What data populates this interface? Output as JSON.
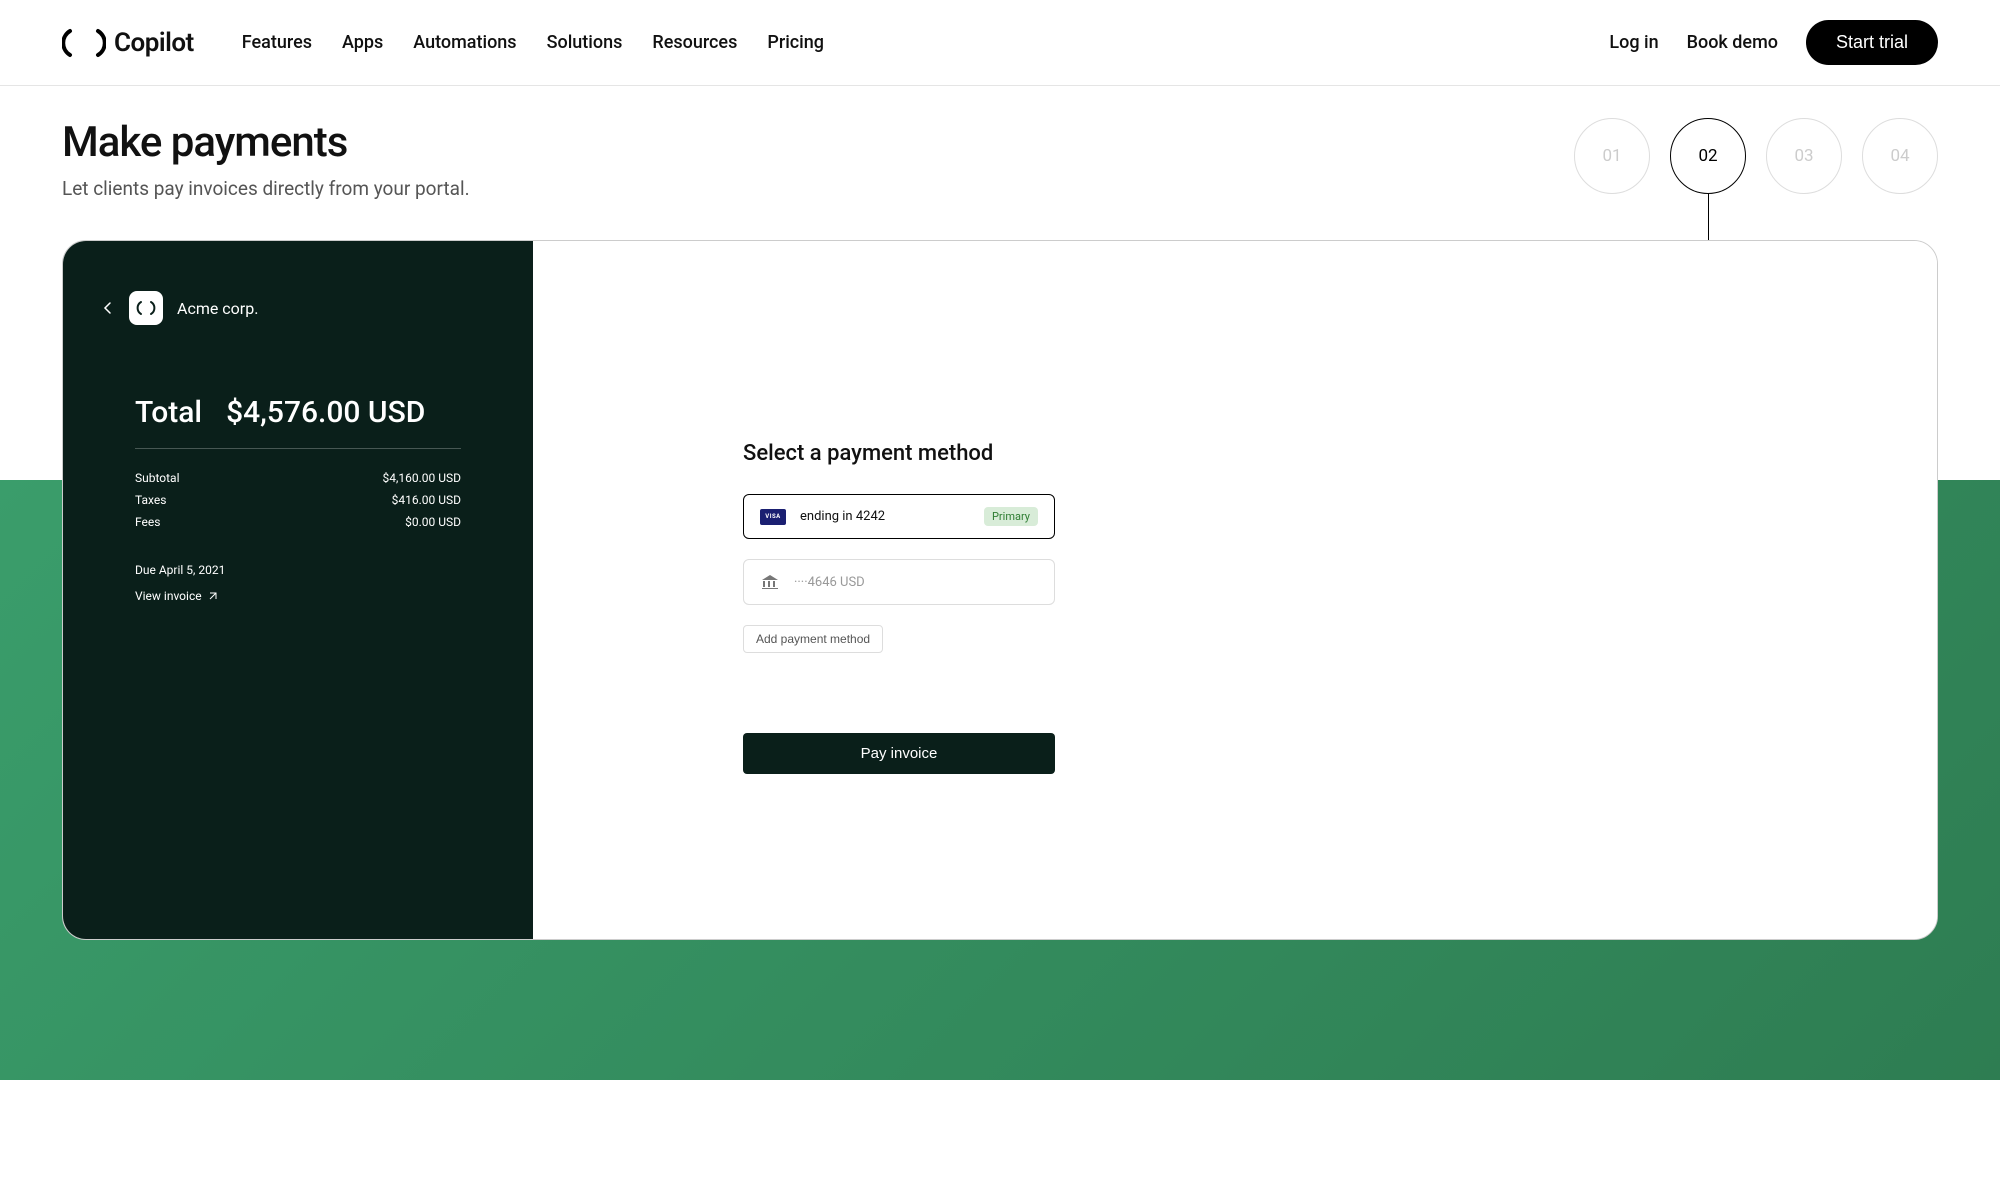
{
  "header": {
    "brand": "Copilot",
    "nav": [
      "Features",
      "Apps",
      "Automations",
      "Solutions",
      "Resources",
      "Pricing"
    ],
    "login": "Log in",
    "book_demo": "Book demo",
    "start_trial": "Start trial"
  },
  "section": {
    "title": "Make payments",
    "subtitle": "Let clients pay invoices directly from your portal.",
    "steps": [
      "01",
      "02",
      "03",
      "04"
    ],
    "active_step": 1
  },
  "invoice": {
    "company": "Acme corp.",
    "total_label": "Total",
    "total_amount": "$4,576.00 USD",
    "lines": [
      {
        "label": "Subtotal",
        "value": "$4,160.00 USD"
      },
      {
        "label": "Taxes",
        "value": "$416.00 USD"
      },
      {
        "label": "Fees",
        "value": "$0.00 USD"
      }
    ],
    "due": "Due April 5, 2021",
    "view": "View invoice"
  },
  "payment": {
    "title": "Select a payment method",
    "card_brand": "VISA",
    "card_label": "ending in 4242",
    "primary_badge": "Primary",
    "bank_label": "····4646 USD",
    "add": "Add payment method",
    "pay": "Pay invoice"
  }
}
